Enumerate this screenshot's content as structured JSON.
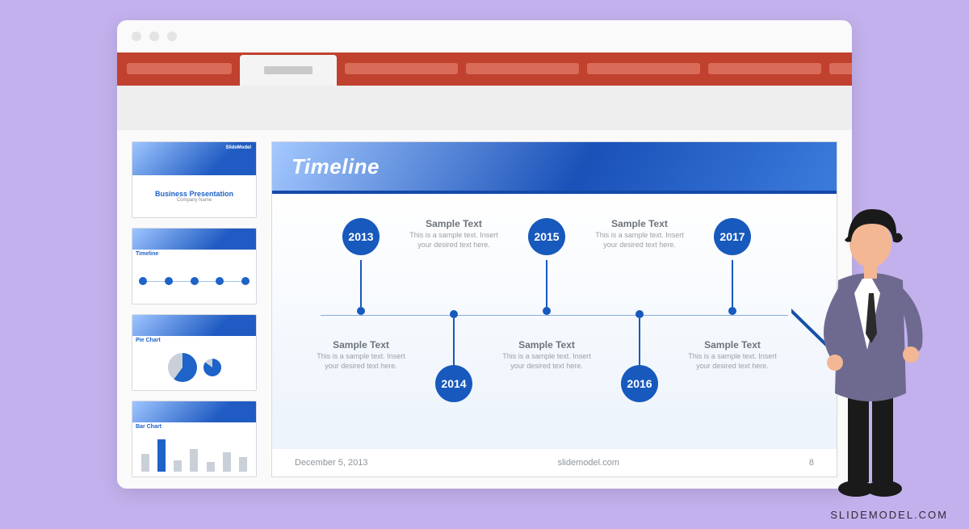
{
  "brand": "SLIDEMODEL.COM",
  "window": {
    "traffic_dots": 3,
    "ribbon_tabs": 7,
    "active_tab_index": 1
  },
  "thumbnails": [
    {
      "type": "title",
      "title": "Business Presentation",
      "subtitle": "Company Name",
      "badge": "SlideModel"
    },
    {
      "type": "timeline",
      "label": "Timeline"
    },
    {
      "type": "pie",
      "label": "Pie Chart"
    },
    {
      "type": "bar",
      "label": "Bar Chart"
    }
  ],
  "slide": {
    "title": "Timeline",
    "footer_date": "December 5, 2013",
    "footer_center": "slidemodel.com",
    "footer_page": "8",
    "sample_heading": "Sample Text",
    "sample_body": "This is a sample text. Insert your desired text here.",
    "timeline": {
      "years_top": [
        "2013",
        "2015",
        "2017"
      ],
      "years_bottom": [
        "2014",
        "2016"
      ]
    }
  },
  "chart_data": {
    "type": "timeline",
    "axis": "year",
    "points": [
      {
        "year": 2013,
        "position": "above",
        "label": "Sample Text",
        "desc": "This is a sample text. Insert your desired text here."
      },
      {
        "year": 2014,
        "position": "below",
        "label": "Sample Text",
        "desc": "This is a sample text. Insert your desired text here."
      },
      {
        "year": 2015,
        "position": "above",
        "label": "Sample Text",
        "desc": "This is a sample text. Insert your desired text here."
      },
      {
        "year": 2016,
        "position": "below",
        "label": "Sample Text",
        "desc": "This is a sample text. Insert your desired text here."
      },
      {
        "year": 2017,
        "position": "above",
        "label": "Sample Text",
        "desc": "This is a sample text. Insert your desired text here."
      }
    ],
    "title": "Timeline"
  }
}
